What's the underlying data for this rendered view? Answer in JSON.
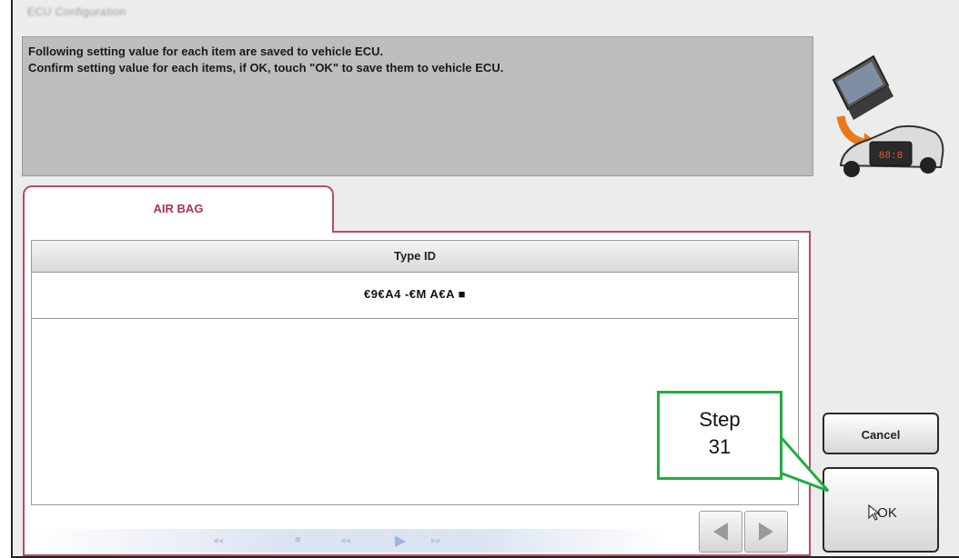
{
  "header": {
    "title": "ECU Configuration"
  },
  "message": {
    "line1": "Following setting value for each item are saved to vehicle ECU.",
    "line2": "Confirm setting value for each items, if OK, touch \"OK\" to save them to vehicle ECU."
  },
  "tab": {
    "label": "AIR BAG"
  },
  "table": {
    "header": "Type ID",
    "value": "€9€A4 -€M A€A ■"
  },
  "buttons": {
    "cancel": "Cancel",
    "ok": "OK"
  },
  "callout": {
    "line1": "Step",
    "line2": "31"
  },
  "colors": {
    "accent": "#c04a5e",
    "callout": "#1fae3f",
    "message_bg": "#bdbdbd"
  },
  "icons": [
    "laptop-to-car-icon",
    "prev-arrow-icon",
    "next-arrow-icon",
    "cursor-icon"
  ]
}
